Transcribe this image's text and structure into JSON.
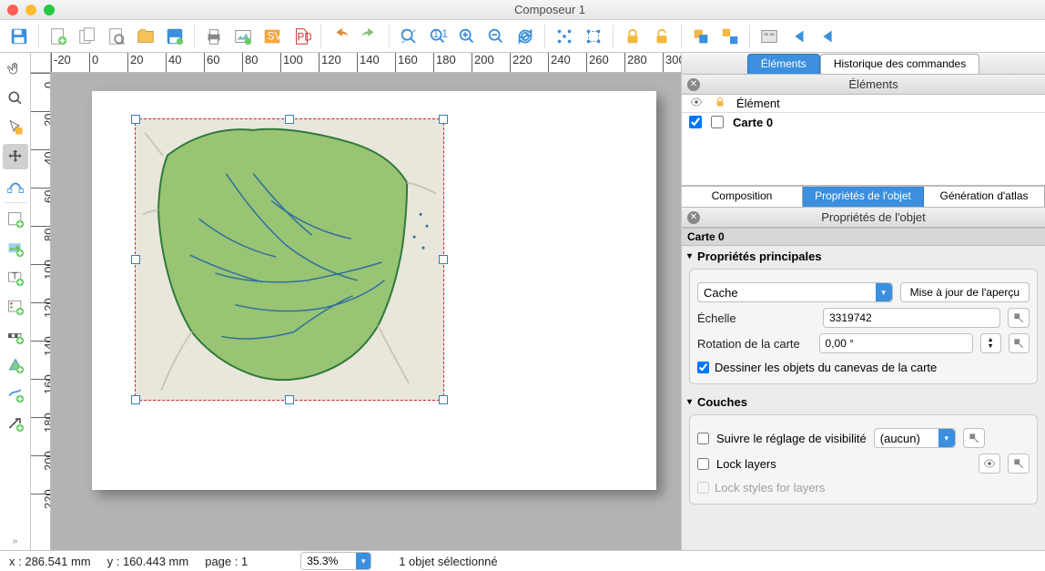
{
  "window": {
    "title": "Composeur 1"
  },
  "top_tabs": {
    "elements": "Éléments",
    "history": "Historique des commandes"
  },
  "elements_panel": {
    "title": "Éléments",
    "header_item": "Élément",
    "row1": "Carte 0"
  },
  "bottom_tabs": {
    "composition": "Composition",
    "item_props": "Propriétés de l'objet",
    "atlas": "Génération d'atlas"
  },
  "props_panel": {
    "title": "Propriétés de l'objet",
    "item_title": "Carte 0",
    "sect_main": "Propriétés principales",
    "cache_mode": "Cache",
    "update_preview": "Mise à jour de l'aperçu",
    "scale_label": "Échelle",
    "scale_value": "3319742",
    "rotation_label": "Rotation de la carte",
    "rotation_value": "0,00 °",
    "draw_canvas_items": "Dessiner les objets du canevas de la carte",
    "sect_layers": "Couches",
    "follow_vis_label": "Suivre le réglage de visibilité",
    "follow_vis_value": "(aucun)",
    "lock_layers": "Lock layers",
    "lock_styles": "Lock styles for layers"
  },
  "status": {
    "x": "x : 286.541 mm",
    "y": "y : 160.443 mm",
    "page": "page : 1",
    "zoom": "35.3%",
    "selection": "1 objet sélectionné"
  },
  "ruler_h": [
    "-20",
    "0",
    "20",
    "40",
    "60",
    "80",
    "100",
    "120",
    "140",
    "160",
    "180",
    "200",
    "220",
    "240",
    "260",
    "280",
    "300"
  ],
  "ruler_v": [
    "0",
    "20",
    "40",
    "60",
    "80",
    "100",
    "120",
    "140",
    "160",
    "180",
    "200",
    "220"
  ]
}
